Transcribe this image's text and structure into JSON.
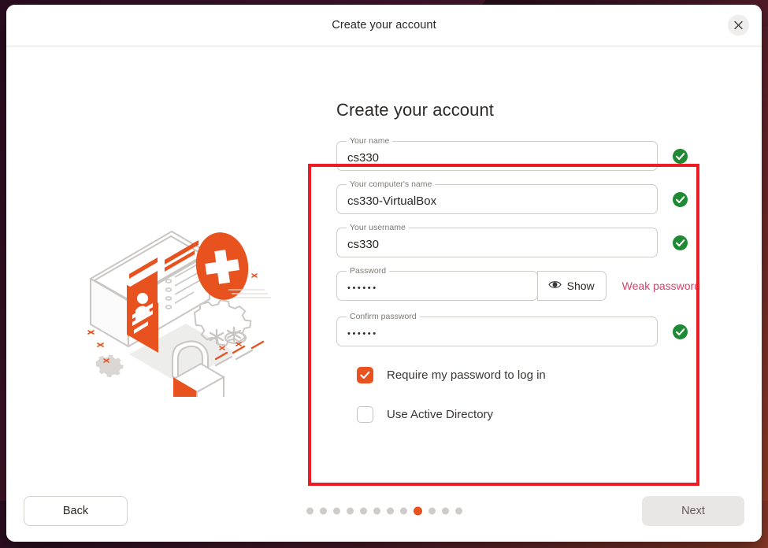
{
  "window": {
    "headerbar_title": "Create your account",
    "close_icon": "close-icon"
  },
  "page": {
    "title": "Create your account"
  },
  "illustration": {
    "name": "create-account-illustration",
    "accent_color": "#e8521f",
    "line_color": "#c9c6c3"
  },
  "form": {
    "fields": [
      {
        "name": "your-name",
        "label": "Your name",
        "value": "cs330",
        "placeholder": "",
        "status": "valid",
        "status_icon": "check-circle-icon"
      },
      {
        "name": "computer-name",
        "label": "Your computer's name",
        "value": "cs330-VirtualBox",
        "placeholder": "",
        "status": "valid",
        "status_icon": "check-circle-icon"
      },
      {
        "name": "username",
        "label": "Your username",
        "value": "cs330",
        "placeholder": "",
        "status": "valid",
        "status_icon": "check-circle-icon"
      },
      {
        "name": "password",
        "label": "Password",
        "value": "••••••",
        "placeholder": "",
        "status": "weak",
        "show_button_label": "Show",
        "show_button_icon": "eye-icon",
        "hint": "Weak password",
        "hint_color": "#d5416b"
      },
      {
        "name": "confirm-password",
        "label": "Confirm password",
        "value": "••••••",
        "placeholder": "",
        "status": "valid",
        "status_icon": "check-circle-icon"
      }
    ],
    "checkboxes": [
      {
        "name": "require-password-to-log-in",
        "label": "Require my password to log in",
        "checked": true
      },
      {
        "name": "use-active-directory",
        "label": "Use Active Directory",
        "checked": false
      }
    ]
  },
  "footer": {
    "back_label": "Back",
    "next_label": "Next",
    "progress": {
      "total_steps": 12,
      "active_step": 9,
      "active_color": "#e8521f",
      "inactive_color": "#cecbc8"
    }
  },
  "annotation": {
    "name": "red-highlight-box",
    "color": "#ed1c24"
  }
}
